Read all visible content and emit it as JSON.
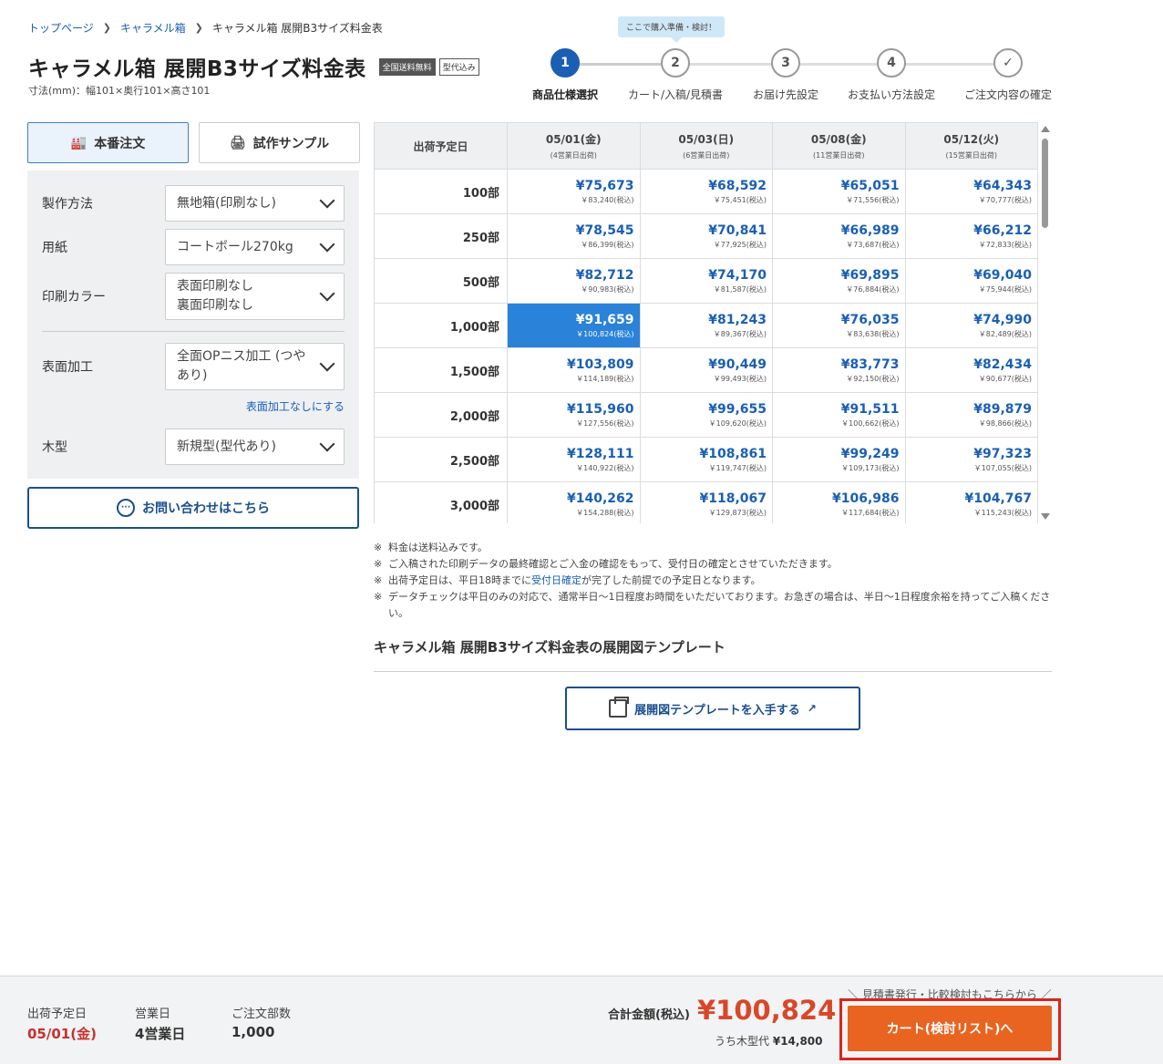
{
  "breadcrumb": [
    {
      "label": "トップページ",
      "link": true
    },
    {
      "label": "キャラメル箱",
      "link": true
    },
    {
      "label": "キャラメル箱 展開B3サイズ料金表",
      "link": false
    }
  ],
  "header": {
    "title": "キャラメル箱 展開B3サイズ料金表",
    "badge_shipping": "全国送料無料",
    "badge_mold": "型代込み",
    "dimensions": "寸法(mm)：幅101×奥行101×高さ101"
  },
  "stepper": {
    "tooltip": "ここで購入準備・検討！",
    "steps": [
      {
        "num": "1",
        "label": "商品仕様選択",
        "active": true
      },
      {
        "num": "2",
        "label": "カート/入稿/見積書",
        "active": false
      },
      {
        "num": "3",
        "label": "お届け先設定",
        "active": false
      },
      {
        "num": "4",
        "label": "お支払い方法設定",
        "active": false
      },
      {
        "num": "✓",
        "label": "ご注文内容の確定",
        "active": false
      }
    ]
  },
  "tabs": {
    "production": "本番注文",
    "sample": "試作サンプル"
  },
  "options": {
    "method": {
      "label": "製作方法",
      "value": "無地箱(印刷なし)"
    },
    "paper": {
      "label": "用紙",
      "value": "コートボール270kg"
    },
    "color": {
      "label": "印刷カラー",
      "value_line1": "表面印刷なし",
      "value_line2": "裏面印刷なし"
    },
    "finish": {
      "label": "表面加工",
      "value_line1": "全面OPニス加工 (つや",
      "value_line2": "あり)"
    },
    "finish_link": "表面加工なしにする",
    "mold": {
      "label": "木型",
      "value": "新規型(型代あり)"
    }
  },
  "contact_button": "お問い合わせはこちら",
  "price_table": {
    "corner": "出荷予定日",
    "dates": [
      {
        "date": "05/01(金)",
        "sub": "(4営業日出荷)"
      },
      {
        "date": "05/03(日)",
        "sub": "(6営業日出荷)"
      },
      {
        "date": "05/08(金)",
        "sub": "(11営業日出荷)"
      },
      {
        "date": "05/12(火)",
        "sub": "(15営業日出荷)"
      }
    ],
    "rows": [
      {
        "qty": "100部",
        "prices": [
          {
            "main": "¥75,673",
            "tax": "￥83,240(税込)"
          },
          {
            "main": "¥68,592",
            "tax": "￥75,451(税込)"
          },
          {
            "main": "¥65,051",
            "tax": "￥71,556(税込)"
          },
          {
            "main": "¥64,343",
            "tax": "￥70,777(税込)"
          }
        ]
      },
      {
        "qty": "250部",
        "prices": [
          {
            "main": "¥78,545",
            "tax": "￥86,399(税込)"
          },
          {
            "main": "¥70,841",
            "tax": "￥77,925(税込)"
          },
          {
            "main": "¥66,989",
            "tax": "￥73,687(税込)"
          },
          {
            "main": "¥66,212",
            "tax": "￥72,833(税込)"
          }
        ]
      },
      {
        "qty": "500部",
        "prices": [
          {
            "main": "¥82,712",
            "tax": "￥90,983(税込)"
          },
          {
            "main": "¥74,170",
            "tax": "￥81,587(税込)"
          },
          {
            "main": "¥69,895",
            "tax": "￥76,884(税込)"
          },
          {
            "main": "¥69,040",
            "tax": "￥75,944(税込)"
          }
        ]
      },
      {
        "qty": "1,000部",
        "prices": [
          {
            "main": "¥91,659",
            "tax": "￥100,824(税込)"
          },
          {
            "main": "¥81,243",
            "tax": "￥89,367(税込)"
          },
          {
            "main": "¥76,035",
            "tax": "￥83,638(税込)"
          },
          {
            "main": "¥74,990",
            "tax": "￥82,489(税込)"
          }
        ]
      },
      {
        "qty": "1,500部",
        "prices": [
          {
            "main": "¥103,809",
            "tax": "￥114,189(税込)"
          },
          {
            "main": "¥90,449",
            "tax": "￥99,493(税込)"
          },
          {
            "main": "¥83,773",
            "tax": "￥92,150(税込)"
          },
          {
            "main": "¥82,434",
            "tax": "￥90,677(税込)"
          }
        ]
      },
      {
        "qty": "2,000部",
        "prices": [
          {
            "main": "¥115,960",
            "tax": "￥127,556(税込)"
          },
          {
            "main": "¥99,655",
            "tax": "￥109,620(税込)"
          },
          {
            "main": "¥91,511",
            "tax": "￥100,662(税込)"
          },
          {
            "main": "¥89,879",
            "tax": "￥98,866(税込)"
          }
        ]
      },
      {
        "qty": "2,500部",
        "prices": [
          {
            "main": "¥128,111",
            "tax": "￥140,922(税込)"
          },
          {
            "main": "¥108,861",
            "tax": "￥119,747(税込)"
          },
          {
            "main": "¥99,249",
            "tax": "￥109,173(税込)"
          },
          {
            "main": "¥97,323",
            "tax": "￥107,055(税込)"
          }
        ]
      },
      {
        "qty": "3,000部",
        "prices": [
          {
            "main": "¥140,262",
            "tax": "￥154,288(税込)"
          },
          {
            "main": "¥118,067",
            "tax": "￥129,873(税込)"
          },
          {
            "main": "¥106,986",
            "tax": "￥117,684(税込)"
          },
          {
            "main": "¥104,767",
            "tax": "￥115,243(税込)"
          }
        ]
      }
    ],
    "selected": {
      "row": 3,
      "col": 0
    }
  },
  "notes": {
    "mark": "※",
    "n1": "料金は送料込みです。",
    "n2": "ご入稿された印刷データの最終確認とご入金の確認をもって、受付日の確定とさせていただきます。",
    "n3_pre": "出荷予定日は、平日18時までに",
    "n3_link": "受付日確定",
    "n3_post": "が完了した前提での予定日となります。",
    "n4": "データチェックは平日のみの対応で、通常半日〜1日程度お時間をいただいております。お急ぎの場合は、半日〜1日程度余裕を持ってご入稿ください。"
  },
  "template": {
    "title": "キャラメル箱 展開B3サイズ料金表の展開図テンプレート",
    "button": "展開図テンプレートを入手する"
  },
  "footer": {
    "ship_label": "出荷予定日",
    "ship_value": "05/01(金)",
    "days_label": "営業日",
    "days_value": "4営業日",
    "qty_label": "ご注文部数",
    "qty_value": "1,000",
    "total_label": "合計金額(税込)",
    "total_value": "¥100,824",
    "mold_label": "うち木型代",
    "mold_value": "¥14,800",
    "quote_note": "＼ 見積書発行・比較検討もこちらから ／",
    "cart_button": "カート(検討リスト)へ"
  },
  "colors": {
    "accent": "#1a5fb4",
    "selected_cell": "#2a82d9",
    "price_red": "#d9472b",
    "cart_orange": "#e96420",
    "highlight_outline": "#d9251c"
  }
}
